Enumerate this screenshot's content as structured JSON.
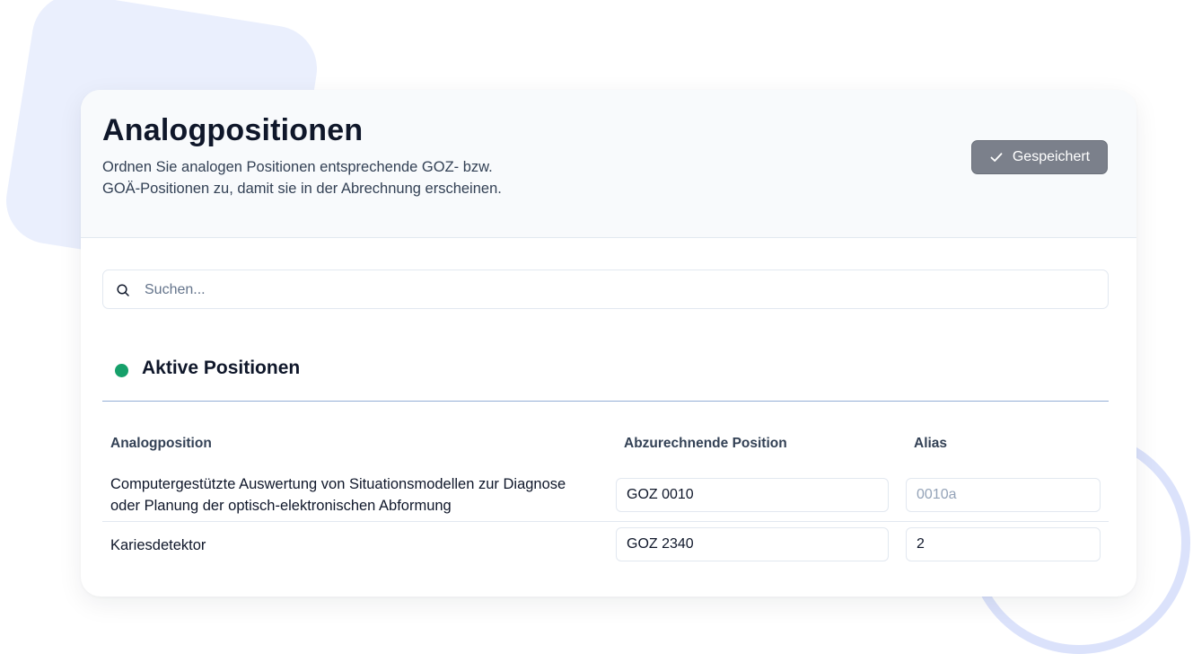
{
  "header": {
    "title": "Analogpositionen",
    "description_line1": "Ordnen Sie analogen Positionen entsprechende GOZ- bzw.",
    "description_line2": "GOÄ-Positionen zu, damit sie in der Abrechnung erscheinen.",
    "saved_button": {
      "label": "Gespeichert",
      "icon": "check-icon"
    }
  },
  "search": {
    "placeholder": "Suchen...",
    "value": "",
    "icon": "search-icon"
  },
  "section": {
    "title": "Aktive Positionen",
    "status_color": "#16a06a"
  },
  "table": {
    "columns": [
      "Analogposition",
      "Abzurechnende Position",
      "Alias"
    ],
    "rows": [
      {
        "description_line1": "Computergestützte Auswertung von Situationsmodellen zur Diagnose",
        "description_line2": "oder Planung der optisch-elektronischen Abformung",
        "position": "GOZ 0010",
        "alias_value": "",
        "alias_placeholder": "0010a"
      },
      {
        "description_line1": "Kariesdetektor",
        "description_line2": "",
        "position": "GOZ 2340",
        "alias_value": "2",
        "alias_placeholder": ""
      }
    ]
  },
  "colors": {
    "saved_button_bg": "#7b808b",
    "section_divider": "#94aed6",
    "status_dot": "#16a06a"
  }
}
